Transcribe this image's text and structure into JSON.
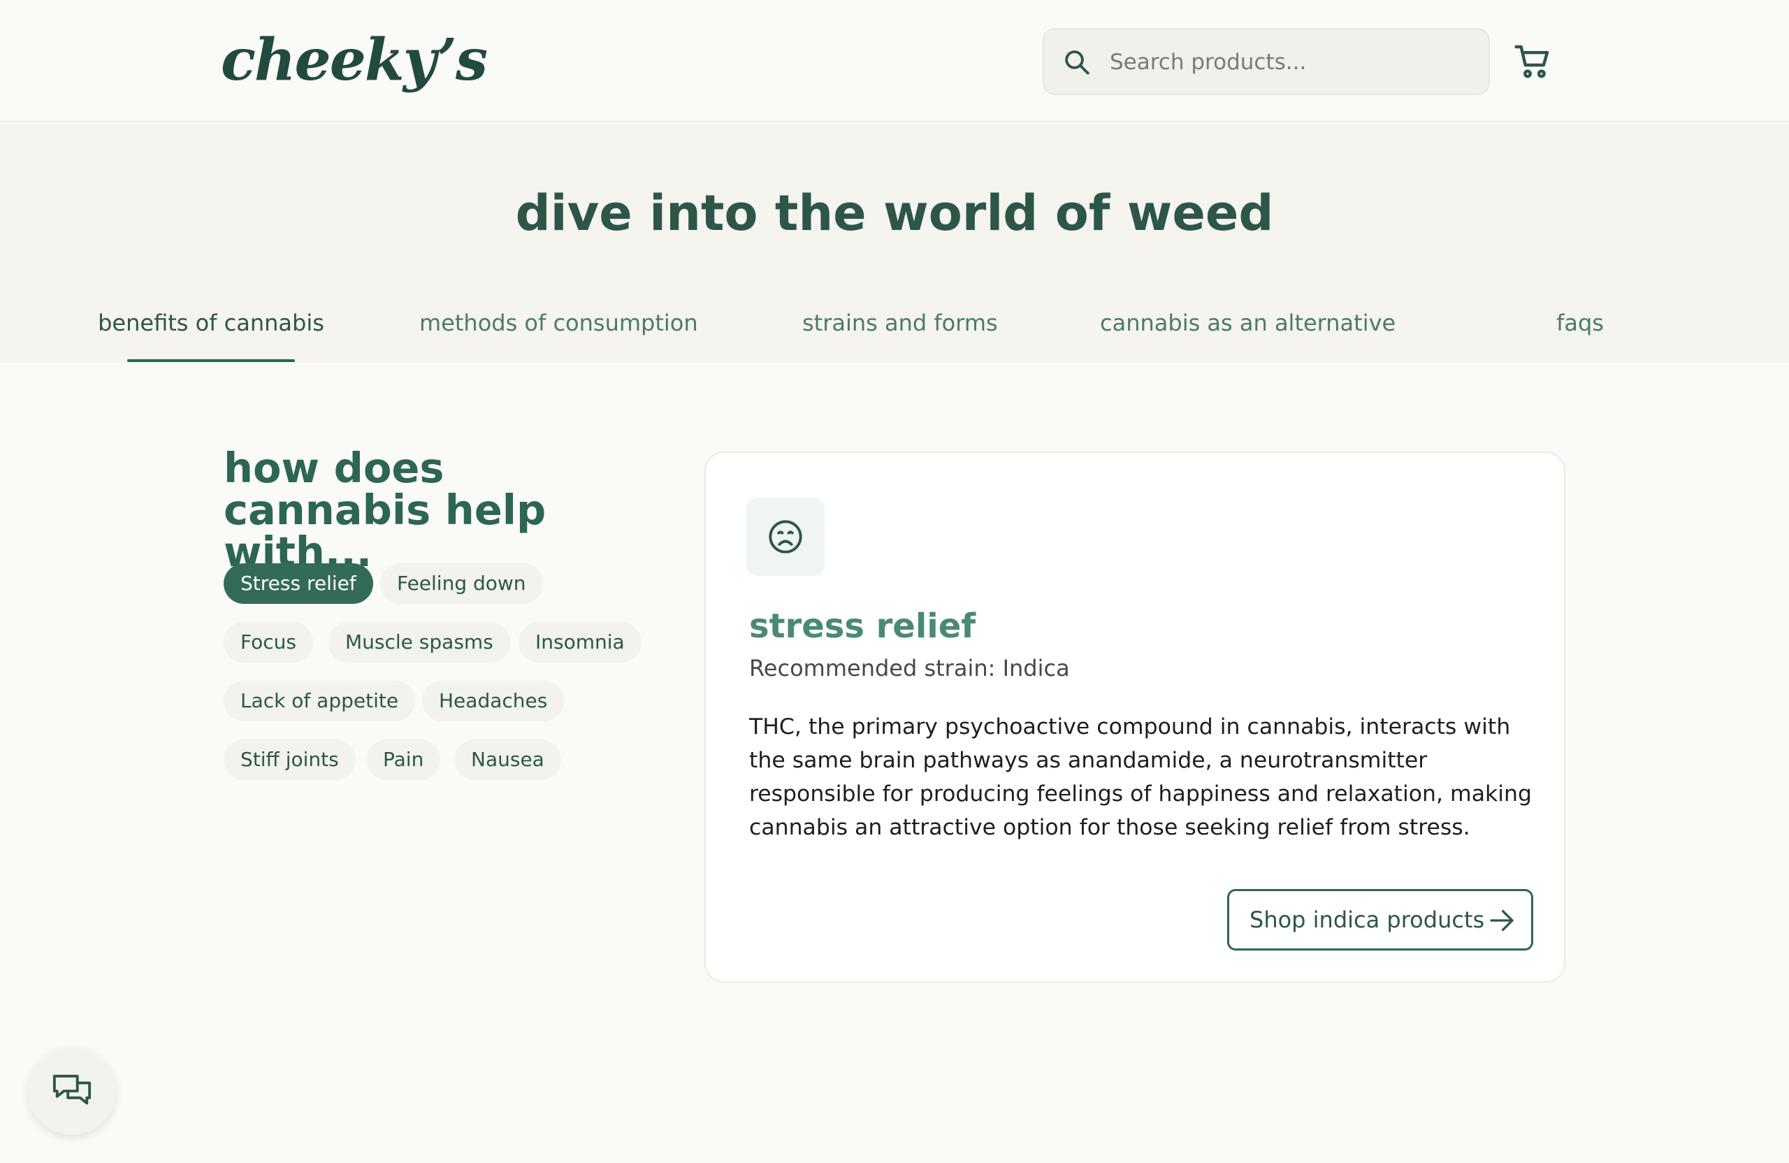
{
  "header": {
    "logo": "cheeky’s",
    "search_placeholder": "Search products..."
  },
  "hero": {
    "title": "dive into the world of weed",
    "tabs": [
      {
        "label": "benefits of cannabis",
        "active": true
      },
      {
        "label": "methods of consumption",
        "active": false
      },
      {
        "label": "strains and forms",
        "active": false
      },
      {
        "label": "cannabis as an alternative",
        "active": false
      },
      {
        "label": "faqs",
        "active": false
      }
    ]
  },
  "benefits": {
    "heading": "how does cannabis help with...",
    "chips": [
      {
        "label": "Stress relief",
        "active": true
      },
      {
        "label": "Feeling down",
        "active": false
      },
      {
        "label": "Focus",
        "active": false
      },
      {
        "label": "Muscle spasms",
        "active": false
      },
      {
        "label": "Insomnia",
        "active": false
      },
      {
        "label": "Lack of appetite",
        "active": false
      },
      {
        "label": "Headaches",
        "active": false
      },
      {
        "label": "Stiff joints",
        "active": false
      },
      {
        "label": "Pain",
        "active": false
      },
      {
        "label": "Nausea",
        "active": false
      }
    ]
  },
  "card": {
    "icon": "frown-face-icon",
    "title": "stress relief",
    "subtitle": "Recommended strain: Indica",
    "body": "THC, the primary psychoactive compound in cannabis, interacts with the same brain pathways as anandamide, a neurotransmitter responsible for producing feelings of happiness and relaxation, making cannabis an attractive option for those seeking relief from stress.",
    "button_label": "Shop indica products"
  },
  "icons": {
    "search": "search-icon",
    "cart": "cart-icon",
    "arrow": "arrow-right-icon",
    "chat": "chat-bubbles-icon"
  },
  "colors": {
    "brand_green": "#2d5648",
    "accent_green": "#346a58",
    "page_background": "#fafaf6",
    "hero_background": "#f5f4ee",
    "chip_background": "#f1f3ec"
  }
}
